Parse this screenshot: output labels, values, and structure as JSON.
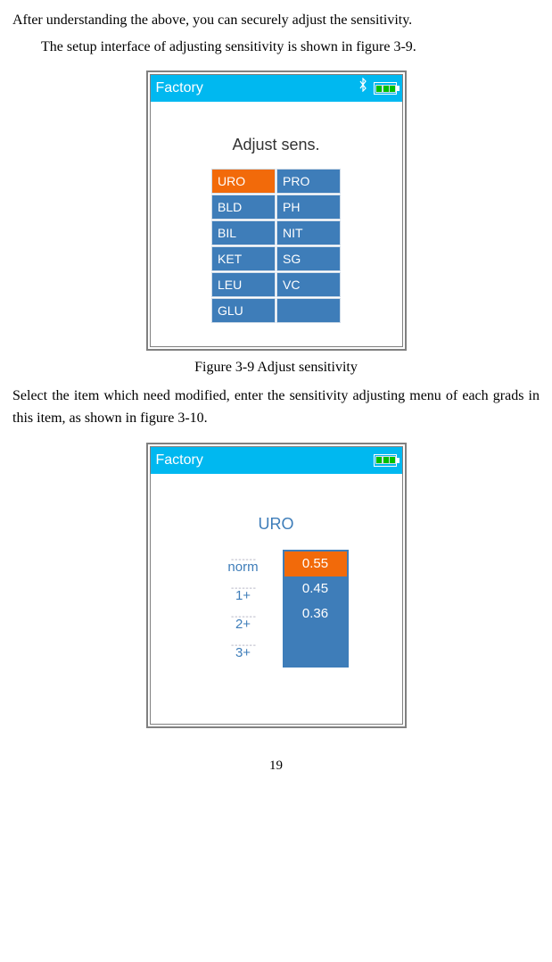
{
  "text": {
    "p1": "After understanding the above, you can securely adjust the sensitivity.",
    "p2": "The setup interface of adjusting sensitivity is shown in figure 3-9.",
    "caption1": "Figure 3-9 Adjust sensitivity",
    "p3": "Select the item which need modified, enter the sensitivity adjusting menu of each grads in this item, as shown in figure 3-10.",
    "page": "19"
  },
  "fig1": {
    "titlebar": "Factory",
    "section": "Adjust sens.",
    "grid": [
      {
        "label": "URO",
        "selected": true
      },
      {
        "label": "PRO"
      },
      {
        "label": "BLD"
      },
      {
        "label": "PH"
      },
      {
        "label": "BIL"
      },
      {
        "label": "NIT"
      },
      {
        "label": "KET"
      },
      {
        "label": "SG"
      },
      {
        "label": "LEU"
      },
      {
        "label": "VC"
      },
      {
        "label": "GLU"
      },
      {
        "label": ""
      }
    ]
  },
  "fig2": {
    "titlebar": "Factory",
    "title": "URO",
    "left": [
      "norm",
      "1+",
      "2+",
      "3+"
    ],
    "right": [
      {
        "v": "0.55",
        "selected": true
      },
      {
        "v": "0.45"
      },
      {
        "v": "0.36"
      }
    ]
  }
}
